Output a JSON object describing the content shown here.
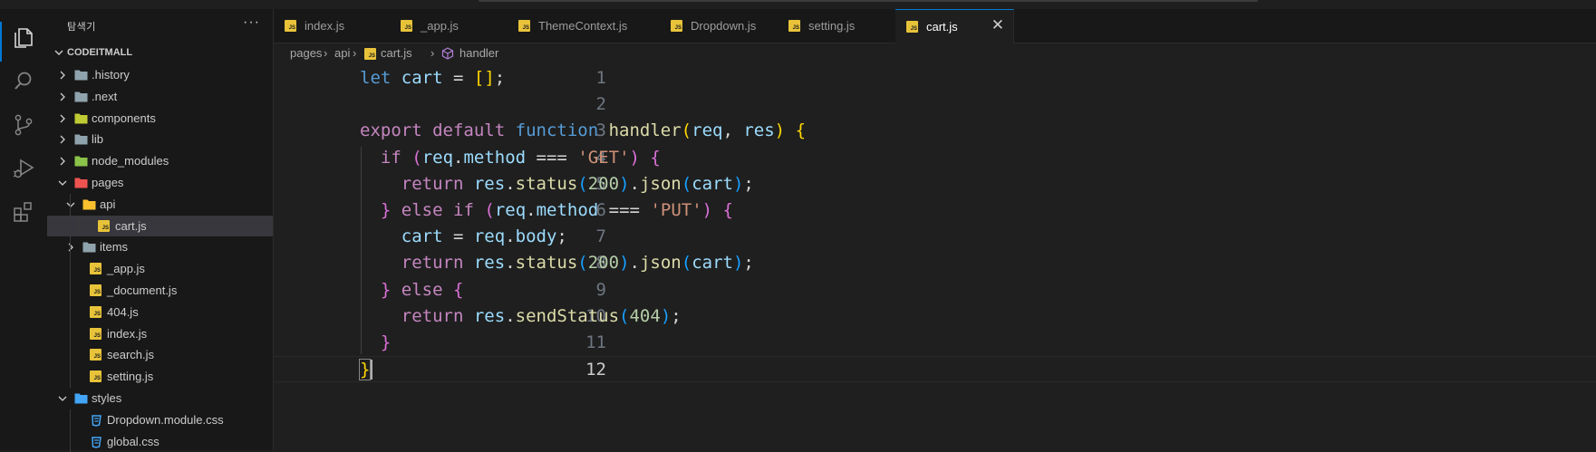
{
  "sidebar": {
    "title": "탐색기",
    "more": "···",
    "root": "CODEITMALL",
    "items": [
      {
        "label": ".history",
        "type": "folder"
      },
      {
        "label": ".next",
        "type": "folder"
      },
      {
        "label": "components",
        "type": "folder"
      },
      {
        "label": "lib",
        "type": "folder"
      },
      {
        "label": "node_modules",
        "type": "folder"
      },
      {
        "label": "pages",
        "type": "folder"
      },
      {
        "label": "api",
        "type": "folder"
      },
      {
        "label": "cart.js",
        "type": "file"
      },
      {
        "label": "items",
        "type": "folder"
      },
      {
        "label": "_app.js",
        "type": "file"
      },
      {
        "label": "_document.js",
        "type": "file"
      },
      {
        "label": "404.js",
        "type": "file"
      },
      {
        "label": "index.js",
        "type": "file"
      },
      {
        "label": "search.js",
        "type": "file"
      },
      {
        "label": "setting.js",
        "type": "file"
      },
      {
        "label": "styles",
        "type": "folder"
      },
      {
        "label": "Dropdown.module.css",
        "type": "file"
      },
      {
        "label": "global.css",
        "type": "file"
      }
    ]
  },
  "tabs": [
    {
      "label": "index.js"
    },
    {
      "label": "_app.js"
    },
    {
      "label": "ThemeContext.js"
    },
    {
      "label": "Dropdown.js"
    },
    {
      "label": "setting.js"
    },
    {
      "label": "cart.js",
      "active": true,
      "close": "✕"
    }
  ],
  "breadcrumb": {
    "parts": [
      "pages",
      "api",
      "cart.js",
      "handler"
    ],
    "sep": "›"
  },
  "editor": {
    "line_numbers": [
      "1",
      "2",
      "3",
      "4",
      "5",
      "6",
      "7",
      "8",
      "9",
      "10",
      "11",
      "12"
    ],
    "current_line": "12",
    "lines": [
      [
        [
          "let",
          "kw"
        ],
        [
          " ",
          "op"
        ],
        [
          "cart",
          "var"
        ],
        [
          " = ",
          "op"
        ],
        [
          "[]",
          "b1"
        ],
        [
          ";",
          "op"
        ]
      ],
      [],
      [
        [
          "export",
          "kw2"
        ],
        [
          " ",
          "op"
        ],
        [
          "default",
          "kw2"
        ],
        [
          " ",
          "op"
        ],
        [
          "function",
          "kw"
        ],
        [
          " ",
          "op"
        ],
        [
          "handler",
          "fn"
        ],
        [
          "(",
          "b1"
        ],
        [
          "req",
          "var"
        ],
        [
          ", ",
          "op"
        ],
        [
          "res",
          "var"
        ],
        [
          ")",
          "b1"
        ],
        [
          " ",
          "op"
        ],
        [
          "{",
          "b1"
        ]
      ],
      [
        [
          "  ",
          "op"
        ],
        [
          "if",
          "kw2"
        ],
        [
          " ",
          "op"
        ],
        [
          "(",
          "b2"
        ],
        [
          "req",
          "var"
        ],
        [
          ".",
          "op"
        ],
        [
          "method",
          "var"
        ],
        [
          " === ",
          "op"
        ],
        [
          "'GET'",
          "str"
        ],
        [
          ")",
          "b2"
        ],
        [
          " ",
          "op"
        ],
        [
          "{",
          "b2"
        ]
      ],
      [
        [
          "    ",
          "op"
        ],
        [
          "return",
          "kw2"
        ],
        [
          " ",
          "op"
        ],
        [
          "res",
          "var"
        ],
        [
          ".",
          "op"
        ],
        [
          "status",
          "fn"
        ],
        [
          "(",
          "b3"
        ],
        [
          "200",
          "num"
        ],
        [
          ")",
          "b3"
        ],
        [
          ".",
          "op"
        ],
        [
          "json",
          "fn"
        ],
        [
          "(",
          "b3"
        ],
        [
          "cart",
          "var"
        ],
        [
          ")",
          "b3"
        ],
        [
          ";",
          "op"
        ]
      ],
      [
        [
          "  ",
          "op"
        ],
        [
          "}",
          "b2"
        ],
        [
          " ",
          "op"
        ],
        [
          "else",
          "kw2"
        ],
        [
          " ",
          "op"
        ],
        [
          "if",
          "kw2"
        ],
        [
          " ",
          "op"
        ],
        [
          "(",
          "b2"
        ],
        [
          "req",
          "var"
        ],
        [
          ".",
          "op"
        ],
        [
          "method",
          "var"
        ],
        [
          " === ",
          "op"
        ],
        [
          "'PUT'",
          "str"
        ],
        [
          ")",
          "b2"
        ],
        [
          " ",
          "op"
        ],
        [
          "{",
          "b2"
        ]
      ],
      [
        [
          "    ",
          "op"
        ],
        [
          "cart",
          "var"
        ],
        [
          " = ",
          "op"
        ],
        [
          "req",
          "var"
        ],
        [
          ".",
          "op"
        ],
        [
          "body",
          "var"
        ],
        [
          ";",
          "op"
        ]
      ],
      [
        [
          "    ",
          "op"
        ],
        [
          "return",
          "kw2"
        ],
        [
          " ",
          "op"
        ],
        [
          "res",
          "var"
        ],
        [
          ".",
          "op"
        ],
        [
          "status",
          "fn"
        ],
        [
          "(",
          "b3"
        ],
        [
          "200",
          "num"
        ],
        [
          ")",
          "b3"
        ],
        [
          ".",
          "op"
        ],
        [
          "json",
          "fn"
        ],
        [
          "(",
          "b3"
        ],
        [
          "cart",
          "var"
        ],
        [
          ")",
          "b3"
        ],
        [
          ";",
          "op"
        ]
      ],
      [
        [
          "  ",
          "op"
        ],
        [
          "}",
          "b2"
        ],
        [
          " ",
          "op"
        ],
        [
          "else",
          "kw2"
        ],
        [
          " ",
          "op"
        ],
        [
          "{",
          "b2"
        ]
      ],
      [
        [
          "    ",
          "op"
        ],
        [
          "return",
          "kw2"
        ],
        [
          " ",
          "op"
        ],
        [
          "res",
          "var"
        ],
        [
          ".",
          "op"
        ],
        [
          "sendStatus",
          "fn"
        ],
        [
          "(",
          "b3"
        ],
        [
          "404",
          "num"
        ],
        [
          ")",
          "b3"
        ],
        [
          ";",
          "op"
        ]
      ],
      [
        [
          "  ",
          "op"
        ],
        [
          "}",
          "b2"
        ]
      ],
      [
        [
          "}",
          "b1 bm"
        ]
      ]
    ]
  },
  "colors": {
    "accent": "#0078d4",
    "js_icon": "#e8c33a",
    "folder": "#90a4ae"
  },
  "icons": {
    "activity": [
      "explorer-icon",
      "search-icon",
      "source-control-icon",
      "run-debug-icon",
      "extensions-icon"
    ]
  }
}
